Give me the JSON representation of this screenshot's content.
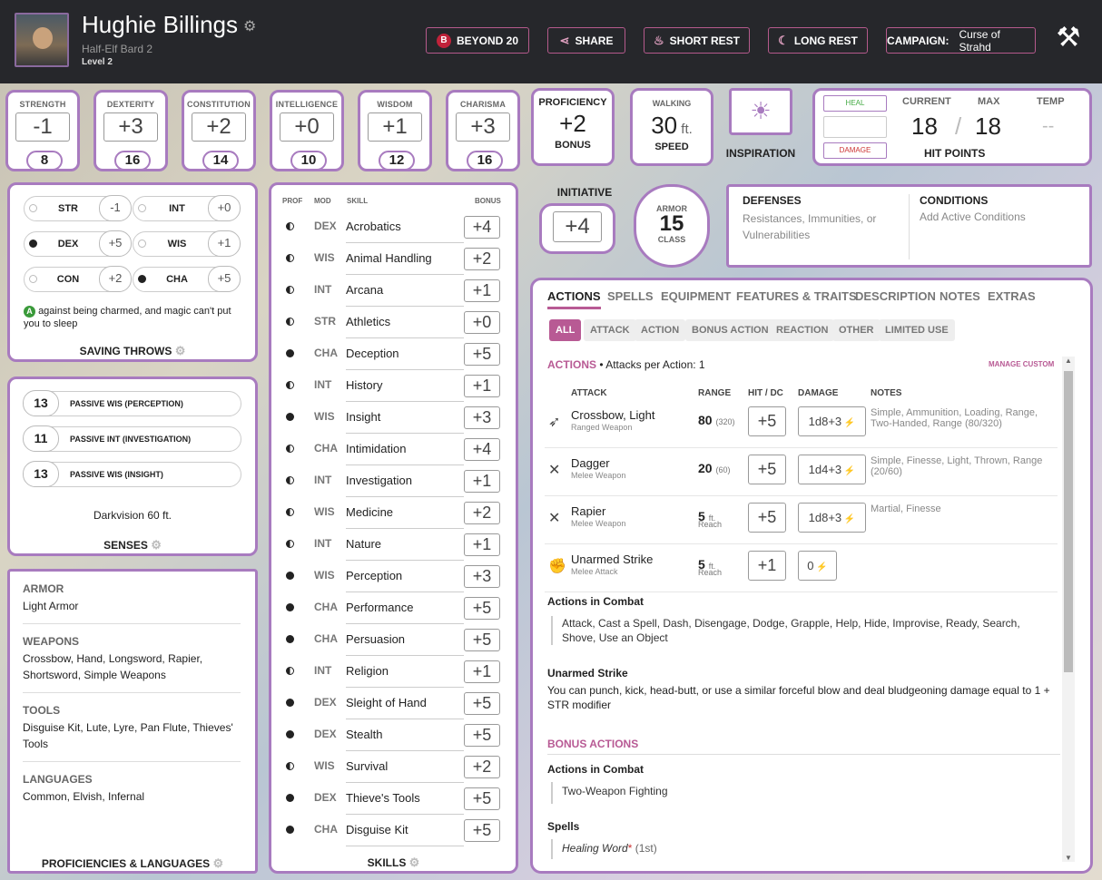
{
  "header": {
    "name": "Hughie Billings",
    "subtitle": "Half-Elf  Bard 2",
    "level": "Level 2",
    "buttons": {
      "b20": "BEYOND 20",
      "share": "SHARE",
      "short": "SHORT REST",
      "long": "LONG REST",
      "camp_label": "CAMPAIGN:",
      "camp_value": "Curse of Strahd"
    }
  },
  "abilities": [
    {
      "label": "STRENGTH",
      "mod": "-1",
      "score": "8"
    },
    {
      "label": "DEXTERITY",
      "mod": "+3",
      "score": "16"
    },
    {
      "label": "CONSTITUTION",
      "mod": "+2",
      "score": "14"
    },
    {
      "label": "INTELLIGENCE",
      "mod": "+0",
      "score": "10"
    },
    {
      "label": "WISDOM",
      "mod": "+1",
      "score": "12"
    },
    {
      "label": "CHARISMA",
      "mod": "+3",
      "score": "16"
    }
  ],
  "proficiency": {
    "top": "PROFICIENCY",
    "value": "+2",
    "bottom": "BONUS"
  },
  "speed": {
    "top": "WALKING",
    "value": "30",
    "unit": "ft.",
    "bottom": "SPEED"
  },
  "inspiration": "INSPIRATION",
  "hp": {
    "heal": "HEAL",
    "damage": "DAMAGE",
    "current_label": "CURRENT",
    "max_label": "MAX",
    "temp_label": "TEMP",
    "current": "18",
    "max": "18",
    "temp": "--",
    "title": "HIT POINTS",
    "slash": "/"
  },
  "initiative": {
    "label": "INITIATIVE",
    "value": "+4"
  },
  "armor": {
    "top": "ARMOR",
    "value": "15",
    "bottom": "CLASS"
  },
  "defenses": {
    "title": "DEFENSES",
    "text": "Resistances, Immunities, or Vulnerabilities"
  },
  "conditions": {
    "title": "CONDITIONS",
    "text": "Add Active Conditions"
  },
  "saves": [
    {
      "name": "STR",
      "val": "-1",
      "prof": false
    },
    {
      "name": "INT",
      "val": "+0",
      "prof": false
    },
    {
      "name": "DEX",
      "val": "+5",
      "prof": true
    },
    {
      "name": "WIS",
      "val": "+1",
      "prof": false
    },
    {
      "name": "CON",
      "val": "+2",
      "prof": false
    },
    {
      "name": "CHA",
      "val": "+5",
      "prof": true
    }
  ],
  "save_note": "against being charmed, and magic can't put you to sleep",
  "save_badge": "A",
  "save_title": "SAVING THROWS",
  "senses": [
    {
      "n": "13",
      "t": "PASSIVE WIS (PERCEPTION)"
    },
    {
      "n": "11",
      "t": "PASSIVE INT (INVESTIGATION)"
    },
    {
      "n": "13",
      "t": "PASSIVE WIS (INSIGHT)"
    }
  ],
  "darkvision": "Darkvision 60 ft.",
  "senses_title": "SENSES",
  "profs": [
    {
      "h": "ARMOR",
      "v": "Light Armor"
    },
    {
      "h": "WEAPONS",
      "v": "Crossbow, Hand, Longsword, Rapier, Shortsword, Simple Weapons"
    },
    {
      "h": "TOOLS",
      "v": "Disguise Kit, Lute, Lyre, Pan Flute, Thieves' Tools"
    },
    {
      "h": "LANGUAGES",
      "v": "Common, Elvish, Infernal"
    }
  ],
  "profs_title": "PROFICIENCIES & LANGUAGES",
  "skill_headers": {
    "prof": "PROF",
    "mod": "MOD",
    "skill": "SKILL",
    "bonus": "BONUS"
  },
  "skills": [
    {
      "ab": "DEX",
      "nm": "Acrobatics",
      "bn": "+4",
      "p": "h"
    },
    {
      "ab": "WIS",
      "nm": "Animal Handling",
      "bn": "+2",
      "p": "h"
    },
    {
      "ab": "INT",
      "nm": "Arcana",
      "bn": "+1",
      "p": "h"
    },
    {
      "ab": "STR",
      "nm": "Athletics",
      "bn": "+0",
      "p": "h"
    },
    {
      "ab": "CHA",
      "nm": "Deception",
      "bn": "+5",
      "p": "f"
    },
    {
      "ab": "INT",
      "nm": "History",
      "bn": "+1",
      "p": "h"
    },
    {
      "ab": "WIS",
      "nm": "Insight",
      "bn": "+3",
      "p": "f"
    },
    {
      "ab": "CHA",
      "nm": "Intimidation",
      "bn": "+4",
      "p": "h"
    },
    {
      "ab": "INT",
      "nm": "Investigation",
      "bn": "+1",
      "p": "h"
    },
    {
      "ab": "WIS",
      "nm": "Medicine",
      "bn": "+2",
      "p": "h"
    },
    {
      "ab": "INT",
      "nm": "Nature",
      "bn": "+1",
      "p": "h"
    },
    {
      "ab": "WIS",
      "nm": "Perception",
      "bn": "+3",
      "p": "f"
    },
    {
      "ab": "CHA",
      "nm": "Performance",
      "bn": "+5",
      "p": "f"
    },
    {
      "ab": "CHA",
      "nm": "Persuasion",
      "bn": "+5",
      "p": "f"
    },
    {
      "ab": "INT",
      "nm": "Religion",
      "bn": "+1",
      "p": "h"
    },
    {
      "ab": "DEX",
      "nm": "Sleight of Hand",
      "bn": "+5",
      "p": "f"
    },
    {
      "ab": "DEX",
      "nm": "Stealth",
      "bn": "+5",
      "p": "f"
    },
    {
      "ab": "WIS",
      "nm": "Survival",
      "bn": "+2",
      "p": "h"
    },
    {
      "ab": "DEX",
      "nm": "Thieve's Tools",
      "bn": "+5",
      "p": "f"
    },
    {
      "ab": "CHA",
      "nm": "Disguise Kit",
      "bn": "+5",
      "p": "f"
    }
  ],
  "skills_title": "SKILLS",
  "tabs": [
    "ACTIONS",
    "SPELLS",
    "EQUIPMENT",
    "FEATURES & TRAITS",
    "DESCRIPTION",
    "NOTES",
    "EXTRAS"
  ],
  "filters": [
    "ALL",
    "ATTACK",
    "ACTION",
    "BONUS ACTION",
    "REACTION",
    "OTHER",
    "LIMITED USE"
  ],
  "actions_label": "ACTIONS",
  "attacks_per": "• Attacks per Action: 1",
  "manage_custom": "MANAGE CUSTOM",
  "attack_cols": {
    "attack": "ATTACK",
    "range": "RANGE",
    "hit": "HIT / DC",
    "damage": "DAMAGE",
    "notes": "NOTES"
  },
  "attacks": [
    {
      "nm": "Crossbow, Light",
      "sb": "Ranged Weapon",
      "rg": "80",
      "rg_small": "(320)",
      "rg2": "",
      "hit": "+5",
      "dmg": "1d8+3",
      "nt": "Simple, Ammunition, Loading, Range, Two-Handed, Range (80/320)",
      "icon": "crossbow-icon"
    },
    {
      "nm": "Dagger",
      "sb": "Melee Weapon",
      "rg": "20",
      "rg_small": "(60)",
      "rg2": "",
      "hit": "+5",
      "dmg": "1d4+3",
      "nt": "Simple, Finesse, Light, Thrown, Range (20/60)",
      "icon": "dagger-icon"
    },
    {
      "nm": "Rapier",
      "sb": "Melee Weapon",
      "rg": "5",
      "rg_small": "ft.",
      "rg2": "Reach",
      "hit": "+5",
      "dmg": "1d8+3",
      "nt": "Martial, Finesse",
      "icon": "rapier-icon"
    },
    {
      "nm": "Unarmed Strike",
      "sb": "Melee Attack",
      "rg": "5",
      "rg_small": "ft.",
      "rg2": "Reach",
      "hit": "+1",
      "dmg": "0",
      "nt": "",
      "icon": "fist-icon"
    }
  ],
  "combat_title": "Actions in Combat",
  "combat_text": "Attack, Cast a Spell, Dash, Disengage, Dodge, Grapple, Help, Hide, Improvise, Ready, Search, Shove, Use an Object",
  "unarmed_title": "Unarmed Strike",
  "unarmed_text": "You can punch, kick, head-butt, or use a similar forceful blow and deal bludgeoning damage equal to 1 + STR modifier",
  "bonus_title": "BONUS ACTIONS",
  "bonus_combat_title": "Actions in Combat",
  "bonus_combat_text": "Two-Weapon Fighting",
  "spells_title": "Spells",
  "spell_name": "Healing Word",
  "spell_mark": "*",
  "spell_level": "(1st)"
}
